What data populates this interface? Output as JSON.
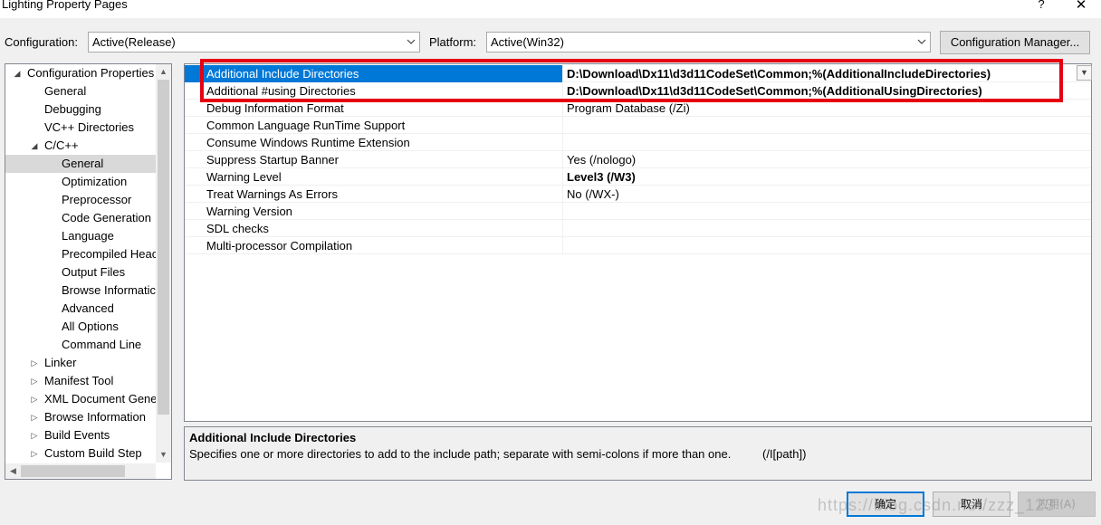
{
  "window": {
    "title": "Lighting Property Pages",
    "help": "?",
    "close": "✕"
  },
  "toolbar": {
    "configuration_label": "Configuration:",
    "configuration_value": "Active(Release)",
    "platform_label": "Platform:",
    "platform_value": "Active(Win32)",
    "config_manager": "Configuration Manager..."
  },
  "tree": [
    {
      "label": "Configuration Properties",
      "level": 0,
      "arrow": "◢"
    },
    {
      "label": "General",
      "level": 1,
      "arrow": ""
    },
    {
      "label": "Debugging",
      "level": 1,
      "arrow": ""
    },
    {
      "label": "VC++ Directories",
      "level": 1,
      "arrow": ""
    },
    {
      "label": "C/C++",
      "level": 1,
      "arrow": "◢"
    },
    {
      "label": "General",
      "level": 2,
      "arrow": ""
    },
    {
      "label": "Optimization",
      "level": 2,
      "arrow": ""
    },
    {
      "label": "Preprocessor",
      "level": 2,
      "arrow": ""
    },
    {
      "label": "Code Generation",
      "level": 2,
      "arrow": ""
    },
    {
      "label": "Language",
      "level": 2,
      "arrow": ""
    },
    {
      "label": "Precompiled Heac",
      "level": 2,
      "arrow": ""
    },
    {
      "label": "Output Files",
      "level": 2,
      "arrow": ""
    },
    {
      "label": "Browse Informatic",
      "level": 2,
      "arrow": ""
    },
    {
      "label": "Advanced",
      "level": 2,
      "arrow": ""
    },
    {
      "label": "All Options",
      "level": 2,
      "arrow": ""
    },
    {
      "label": "Command Line",
      "level": 2,
      "arrow": ""
    },
    {
      "label": "Linker",
      "level": 1,
      "arrow": "▷"
    },
    {
      "label": "Manifest Tool",
      "level": 1,
      "arrow": "▷"
    },
    {
      "label": "XML Document Gene",
      "level": 1,
      "arrow": "▷"
    },
    {
      "label": "Browse Information",
      "level": 1,
      "arrow": "▷"
    },
    {
      "label": "Build Events",
      "level": 1,
      "arrow": "▷"
    },
    {
      "label": "Custom Build Step",
      "level": 1,
      "arrow": "▷"
    }
  ],
  "tree_selected_index": 5,
  "properties": [
    {
      "name": "Additional Include Directories",
      "value": "D:\\Download\\Dx11\\d3d11CodeSet\\Common;%(AdditionalIncludeDirectories)",
      "bold": true
    },
    {
      "name": "Additional #using Directories",
      "value": "D:\\Download\\Dx11\\d3d11CodeSet\\Common;%(AdditionalUsingDirectories)",
      "bold": true
    },
    {
      "name": "Debug Information Format",
      "value": "Program Database (/Zi)",
      "bold": false
    },
    {
      "name": "Common Language RunTime Support",
      "value": "",
      "bold": false
    },
    {
      "name": "Consume Windows Runtime Extension",
      "value": "",
      "bold": false
    },
    {
      "name": "Suppress Startup Banner",
      "value": "Yes (/nologo)",
      "bold": false
    },
    {
      "name": "Warning Level",
      "value": "Level3 (/W3)",
      "bold": true
    },
    {
      "name": "Treat Warnings As Errors",
      "value": "No (/WX-)",
      "bold": false
    },
    {
      "name": "Warning Version",
      "value": "",
      "bold": false
    },
    {
      "name": "SDL checks",
      "value": "",
      "bold": false
    },
    {
      "name": "Multi-processor Compilation",
      "value": "",
      "bold": false
    }
  ],
  "property_selected_index": 0,
  "description": {
    "title": "Additional Include Directories",
    "text": "Specifies one or more directories to add to the include path; separate with semi-colons if more than one.",
    "switch": "(/I[path])"
  },
  "buttons": {
    "ok": "确定",
    "cancel": "取消",
    "apply": "应用(A)"
  },
  "watermark": "https://blog.csdn.net/zzz_123",
  "colors": {
    "selection": "#0078d7",
    "tree_selection": "#d9d9d9",
    "highlight_box": "#e60012"
  }
}
